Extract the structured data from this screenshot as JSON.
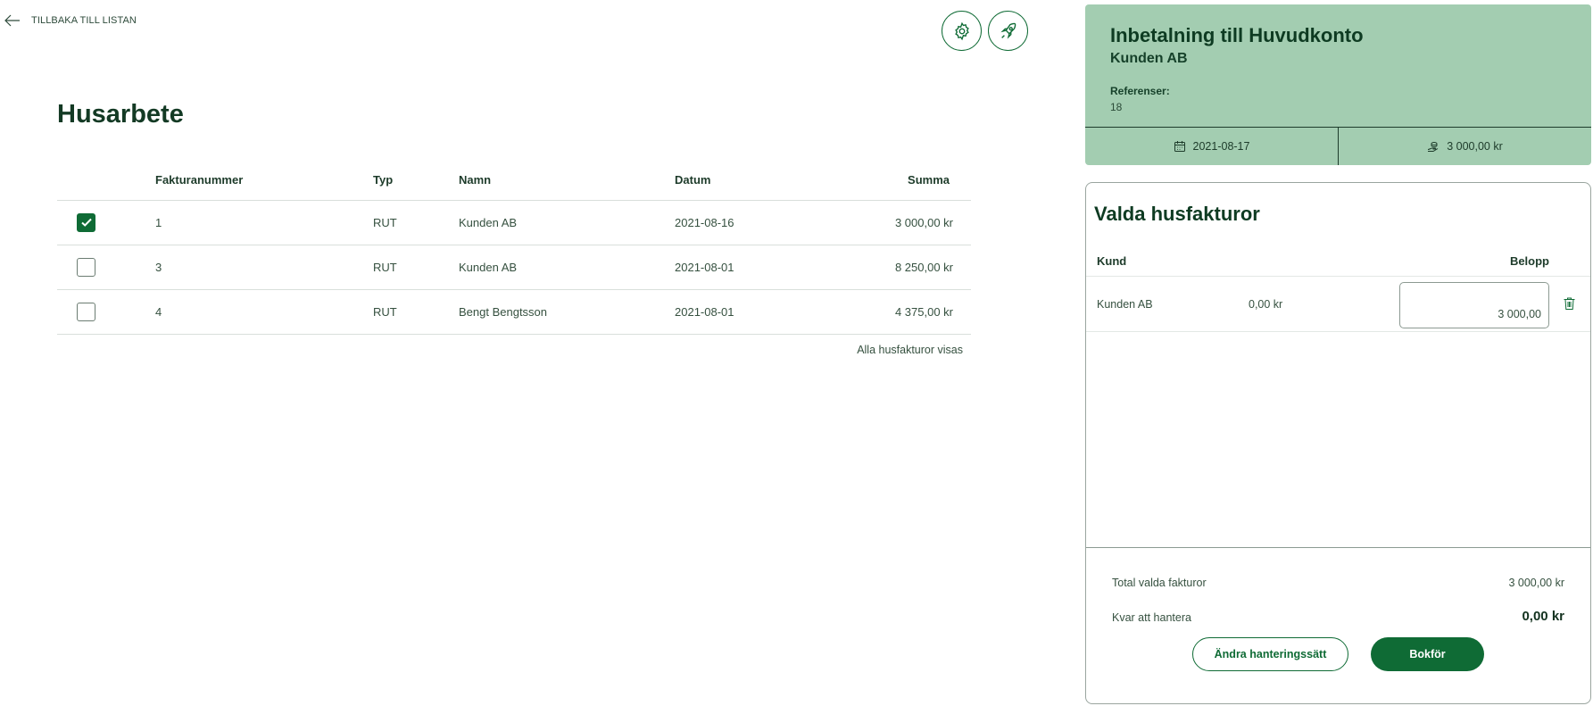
{
  "nav": {
    "back_label": "TILLBAKA TILL LISTAN"
  },
  "toolbar": {
    "settings_icon": "gear-icon",
    "rocket_icon": "rocket-icon"
  },
  "page": {
    "title": "Husarbete"
  },
  "table": {
    "headers": {
      "number": "Fakturanummer",
      "type": "Typ",
      "name": "Namn",
      "date": "Datum",
      "sum": "Summa"
    },
    "rows": [
      {
        "checked": true,
        "number": "1",
        "type": "RUT",
        "name": "Kunden AB",
        "date": "2021-08-16",
        "sum": "3 000,00 kr"
      },
      {
        "checked": false,
        "number": "3",
        "type": "RUT",
        "name": "Kunden AB",
        "date": "2021-08-01",
        "sum": "8 250,00 kr"
      },
      {
        "checked": false,
        "number": "4",
        "type": "RUT",
        "name": "Bengt Bengtsson",
        "date": "2021-08-01",
        "sum": "4 375,00 kr"
      }
    ],
    "footer_text": "Alla husfakturor visas"
  },
  "summary": {
    "title": "Inbetalning till Huvudkonto",
    "customer": "Kunden AB",
    "references_label": "Referenser:",
    "references_value": "18",
    "date": "2021-08-17",
    "amount": "3 000,00 kr"
  },
  "selected": {
    "title": "Valda husfakturor",
    "col_customer": "Kund",
    "col_amount": "Belopp",
    "rows": [
      {
        "customer": "Kunden AB",
        "remaining": "0,00 kr",
        "amount": "3 000,00"
      }
    ],
    "total_label": "Total valda fakturor",
    "total_value": "3 000,00 kr",
    "remaining_label": "Kvar att hantera",
    "remaining_value": "0,00 kr",
    "change_button": "Ändra hanteringssätt",
    "book_button": "Bokför"
  },
  "colors": {
    "accent": "#0f6b35",
    "card_bg": "#a3cdb1",
    "text_dark": "#133a24"
  }
}
